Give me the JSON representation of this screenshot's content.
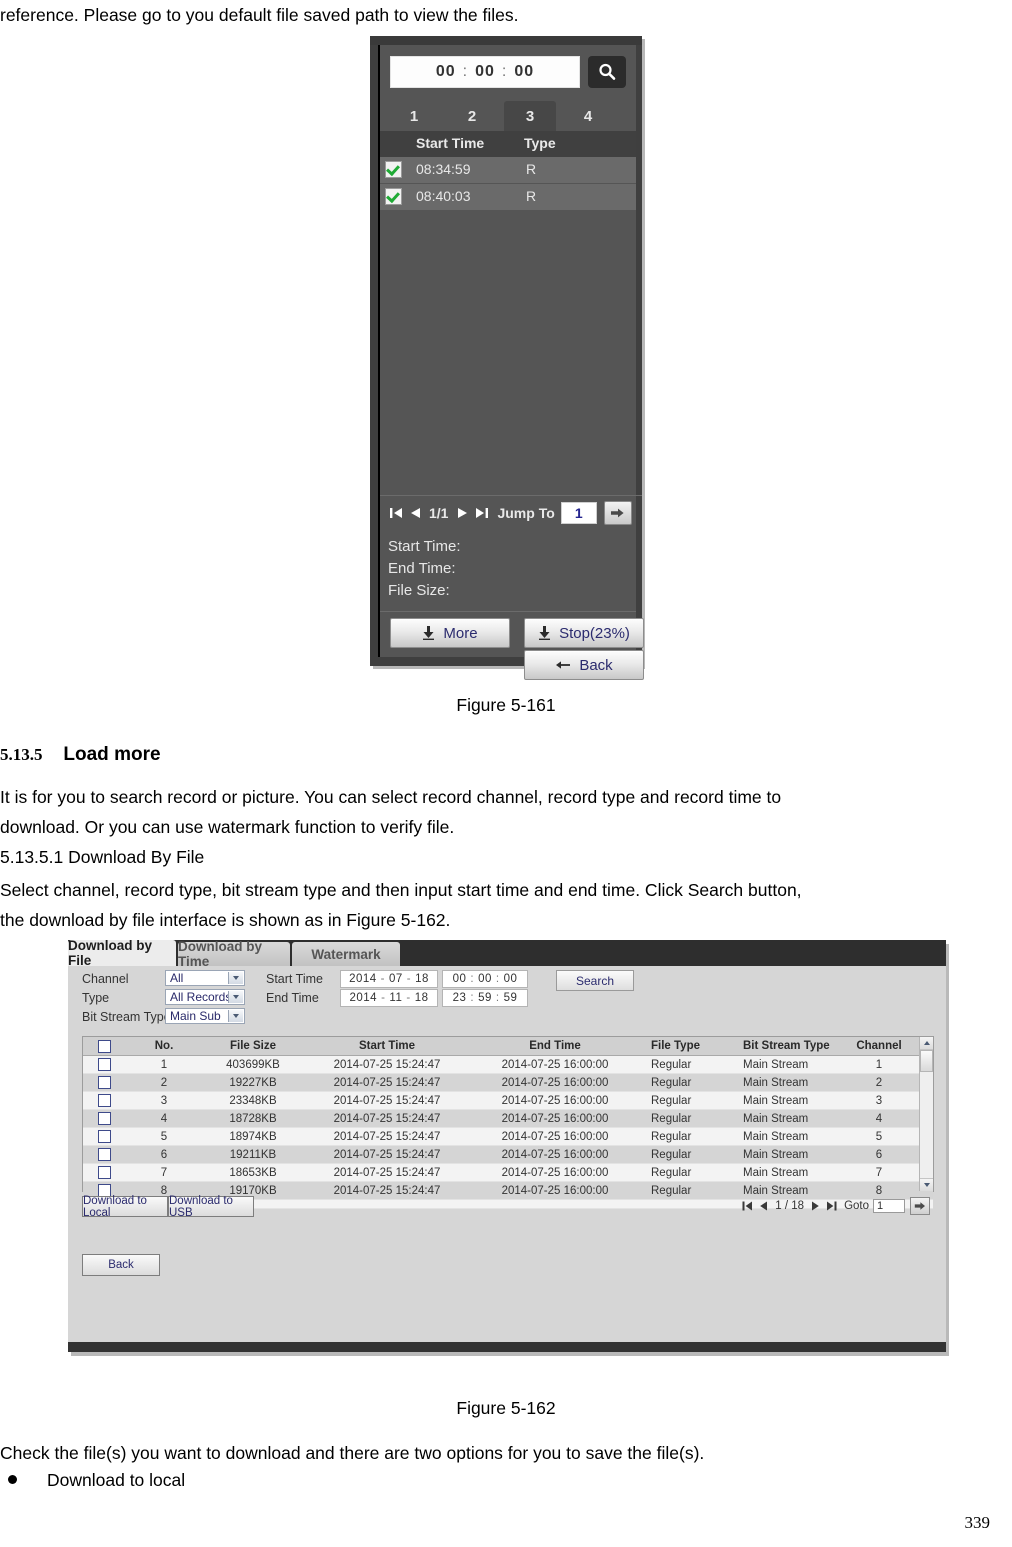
{
  "page": {
    "number": "339",
    "top_paragraph": "reference. Please go to you default file saved path to view the files.",
    "figure1_caption": "Figure 5-161",
    "section_number": "5.13.5",
    "section_title": "Load more",
    "section_body_line1": "It is for you to search record or picture. You can select record channel, record type and record time to",
    "section_body_line2": "download. Or you can use watermark function to verify file.",
    "subsection_heading": "5.13.5.1  Download By File",
    "subsection_body_line1": "Select channel, record type, bit stream type and then input start time and end time. Click Search button,",
    "subsection_body_line2": "the download by file interface is shown as in Figure 5-162.",
    "figure2_caption": "Figure 5-162",
    "closing_paragraph": "Check the file(s) you want to download and there are two options for you to save the file(s).",
    "bullet_item": "Download to local"
  },
  "figure1": {
    "time_hh": "00",
    "time_mm": "00",
    "time_ss": "00",
    "time_separator": ":",
    "search_icon": "magnifier-icon",
    "channel_tabs": [
      "1",
      "2",
      "3",
      "4"
    ],
    "active_channel_tab": "3",
    "columns": [
      "Start Time",
      "Type"
    ],
    "rows": [
      {
        "checked": true,
        "start_time": "08:34:59",
        "type": "R"
      },
      {
        "checked": true,
        "start_time": "08:40:03",
        "type": "R"
      }
    ],
    "pager": {
      "first_icon": "first-page-icon",
      "prev_icon": "prev-page-icon",
      "page_label": "1/1",
      "next_icon": "next-page-icon",
      "last_icon": "last-page-icon",
      "jump_label": "Jump To",
      "jump_value": "1",
      "go_icon": "go-arrow-icon"
    },
    "info": {
      "start_time_label": "Start Time:",
      "end_time_label": "End Time:",
      "file_size_label": "File Size:",
      "start_time_value": "",
      "end_time_value": "",
      "file_size_value": ""
    },
    "buttons": {
      "more": "More",
      "stop": "Stop(23%)",
      "back": "Back",
      "more_icon": "download-icon",
      "stop_icon": "download-icon",
      "back_icon": "left-arrow-icon"
    }
  },
  "figure2": {
    "tabs": [
      "Download by File",
      "Download by Time",
      "Watermark"
    ],
    "active_tab": "Download by File",
    "form": {
      "channel_label": "Channel",
      "channel_value": "All",
      "type_label": "Type",
      "type_value": "All Records",
      "bit_stream_label": "Bit Stream Type",
      "bit_stream_value": "Main Sub",
      "start_time_label": "Start Time",
      "end_time_label": "End Time",
      "start_date": {
        "y": "2014",
        "m": "07",
        "d": "18"
      },
      "start_clock": {
        "h": "00",
        "m": "00",
        "s": "00"
      },
      "end_date": {
        "y": "2014",
        "m": "11",
        "d": "18"
      },
      "end_clock": {
        "h": "23",
        "m": "59",
        "s": "59"
      },
      "date_separator": "-",
      "time_separator": ":",
      "search_button": "Search"
    },
    "table": {
      "columns": [
        "",
        "No.",
        "File Size",
        "Start Time",
        "End Time",
        "File Type",
        "Bit Stream Type",
        "Channel"
      ],
      "rows": [
        {
          "no": "1",
          "size": "403699KB",
          "start": "2014-07-25 15:24:47",
          "end": "2014-07-25 16:00:00",
          "ftype": "Regular",
          "btype": "Main Stream",
          "channel": "1"
        },
        {
          "no": "2",
          "size": "19227KB",
          "start": "2014-07-25 15:24:47",
          "end": "2014-07-25 16:00:00",
          "ftype": "Regular",
          "btype": "Main Stream",
          "channel": "2"
        },
        {
          "no": "3",
          "size": "23348KB",
          "start": "2014-07-25 15:24:47",
          "end": "2014-07-25 16:00:00",
          "ftype": "Regular",
          "btype": "Main Stream",
          "channel": "3"
        },
        {
          "no": "4",
          "size": "18728KB",
          "start": "2014-07-25 15:24:47",
          "end": "2014-07-25 16:00:00",
          "ftype": "Regular",
          "btype": "Main Stream",
          "channel": "4"
        },
        {
          "no": "5",
          "size": "18974KB",
          "start": "2014-07-25 15:24:47",
          "end": "2014-07-25 16:00:00",
          "ftype": "Regular",
          "btype": "Main Stream",
          "channel": "5"
        },
        {
          "no": "6",
          "size": "19211KB",
          "start": "2014-07-25 15:24:47",
          "end": "2014-07-25 16:00:00",
          "ftype": "Regular",
          "btype": "Main Stream",
          "channel": "6"
        },
        {
          "no": "7",
          "size": "18653KB",
          "start": "2014-07-25 15:24:47",
          "end": "2014-07-25 16:00:00",
          "ftype": "Regular",
          "btype": "Main Stream",
          "channel": "7"
        },
        {
          "no": "8",
          "size": "19170KB",
          "start": "2014-07-25 15:24:47",
          "end": "2014-07-25 16:00:00",
          "ftype": "Regular",
          "btype": "Main Stream",
          "channel": "8"
        }
      ]
    },
    "buttons": {
      "download_local": "Download to Local",
      "download_usb": "Download to USB",
      "back": "Back"
    },
    "pager": {
      "first_icon": "first-page-icon",
      "prev_icon": "prev-page-icon",
      "page_label": "1 / 18",
      "next_icon": "next-page-icon",
      "last_icon": "last-page-icon",
      "goto_label": "Goto",
      "goto_value": "1",
      "go_icon": "go-arrow-icon"
    }
  }
}
